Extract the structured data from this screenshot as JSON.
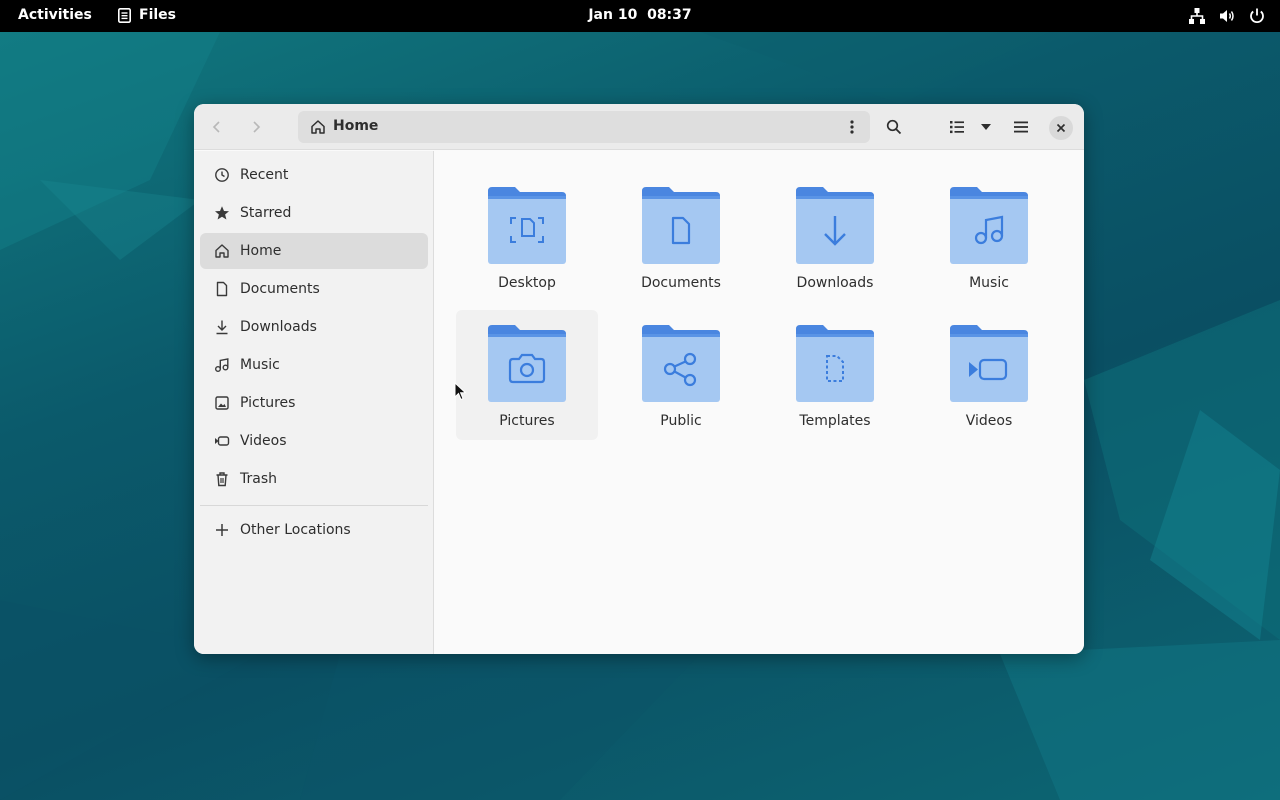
{
  "topbar": {
    "activities": "Activities",
    "app_name": "Files",
    "clock": "Jan 10  08:37",
    "tray_icons": [
      "network-icon",
      "volume-icon",
      "power-icon"
    ]
  },
  "window": {
    "path_label": "Home",
    "buttons": [
      "back",
      "forward",
      "path-menu",
      "search",
      "list-view",
      "view-options",
      "main-menu",
      "close"
    ]
  },
  "sidebar": {
    "items": [
      {
        "label": "Recent",
        "icon": "clock-icon"
      },
      {
        "label": "Starred",
        "icon": "star-icon"
      },
      {
        "label": "Home",
        "icon": "home-icon",
        "active": true
      },
      {
        "label": "Documents",
        "icon": "document-icon"
      },
      {
        "label": "Downloads",
        "icon": "download-icon"
      },
      {
        "label": "Music",
        "icon": "music-icon"
      },
      {
        "label": "Pictures",
        "icon": "picture-icon"
      },
      {
        "label": "Videos",
        "icon": "video-icon"
      },
      {
        "label": "Trash",
        "icon": "trash-icon"
      }
    ],
    "other_locations": "Other Locations"
  },
  "folders": [
    {
      "name": "Desktop",
      "icon": "desktop"
    },
    {
      "name": "Documents",
      "icon": "document"
    },
    {
      "name": "Downloads",
      "icon": "download"
    },
    {
      "name": "Music",
      "icon": "music"
    },
    {
      "name": "Pictures",
      "icon": "camera"
    },
    {
      "name": "Public",
      "icon": "share"
    },
    {
      "name": "Templates",
      "icon": "template"
    },
    {
      "name": "Videos",
      "icon": "video"
    }
  ],
  "colors": {
    "folder_back": "#4a86e0",
    "folder_front": "#a5c8f2",
    "folder_glyph": "#3b7ddd"
  }
}
